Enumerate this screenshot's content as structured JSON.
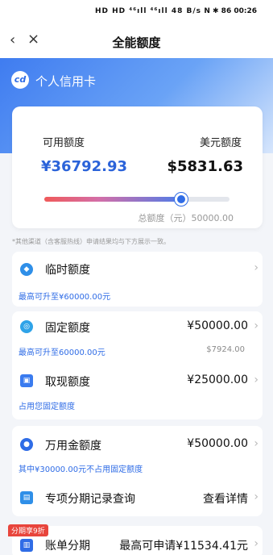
{
  "status_bar": {
    "left": "HD HD ⁴⁶ıll ⁴⁶ıll 48 B/s",
    "right": "N ✱ 86 00:26"
  },
  "nav": {
    "back": "‹",
    "close": "×",
    "title": "全能额度"
  },
  "card": {
    "logo": "cd",
    "title": "个人信用卡"
  },
  "quota": {
    "available_label": "可用额度",
    "available_value": "¥36792.93",
    "usd_label": "美元额度",
    "usd_value": "$5831.63",
    "used_fraction": 0.74,
    "total_label": "总额度（元）50000.00"
  },
  "note": "*其他渠道（含客服热线）申请结果均与下方展示一致。",
  "items": {
    "temp": {
      "label": "临时额度",
      "sub": "最高可升至¥60000.00元"
    },
    "fixed": {
      "label": "固定额度",
      "value": "¥50000.00",
      "sub": "最高可升至60000.00元",
      "sub_right": "$7924.00"
    },
    "cash": {
      "label": "取现额度",
      "value": "¥25000.00",
      "sub": "占用您固定额度"
    },
    "universal": {
      "label": "万用金额度",
      "value": "¥50000.00",
      "sub": "其中¥30000.00元不占用固定额度"
    },
    "installment_query": {
      "label": "专项分期记录查询",
      "value": "查看详情"
    },
    "bill_installment": {
      "badge": "分期享9折",
      "label": "账单分期",
      "value": "最高可申请¥11534.41元"
    }
  },
  "chevron": "›",
  "colors": {
    "accent": "#2f6ce6",
    "promo": "#e8453c",
    "temp_icon": "#2f8fe8",
    "fixed_icon": "#2fa3e8",
    "cash_icon": "#3a7bef",
    "universal_icon": "#2f6ce6",
    "query_icon": "#2f8fe8",
    "bill_icon": "#2f6ce6"
  }
}
